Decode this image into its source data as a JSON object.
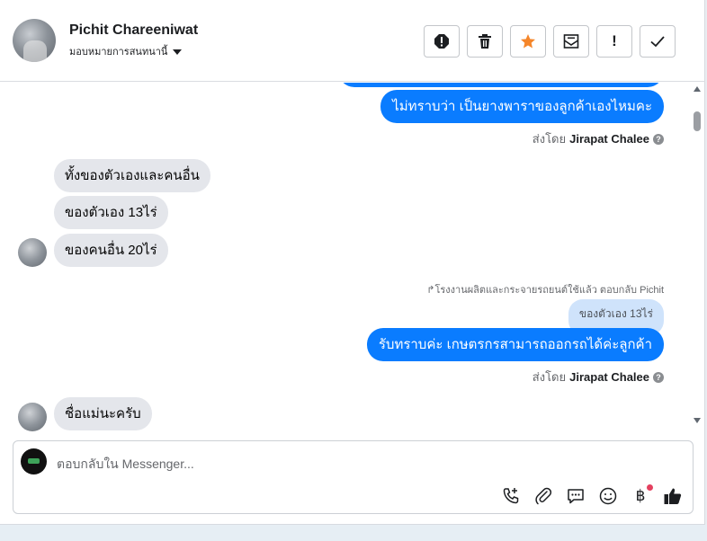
{
  "header": {
    "contact_name": "Pichit Chareeniwat",
    "assign_label": "มอบหมายการสนทนานี้",
    "actions": [
      {
        "name": "spam-icon",
        "color": "#1c1e21"
      },
      {
        "name": "trash-icon",
        "color": "#1c1e21"
      },
      {
        "name": "star-icon",
        "color": "#f5862a"
      },
      {
        "name": "mark-unread-icon",
        "color": "#1c1e21"
      },
      {
        "name": "follow-up-icon",
        "color": "#1c1e21"
      },
      {
        "name": "done-check-icon",
        "color": "#1c1e21"
      }
    ],
    "follow_up_glyph": "!"
  },
  "messages": {
    "out_1": "ไม่ทราบว่า เป็นยางพาราของลูกค้าเองไหมคะ",
    "sent_by_1_prefix": "ส่งโดย",
    "sent_by_1_name": "Jirapat Chalee",
    "in_1": "ทั้งของตัวเองและคนอื่น",
    "in_2": "ของตัวเอง 13ไร่",
    "in_3": "ของคนอื่น 20ไร่",
    "reply_note": "โรงงานผลิตและกระจายรถยนต์ใช้แล้ว ตอบกลับ Pichit",
    "quoted": "ของตัวเอง 13ไร่",
    "out_2": "รับทราบค่ะ เกษตรกรสามารถออกรถได้ค่ะลูกค้า",
    "sent_by_2_prefix": "ส่งโดย",
    "sent_by_2_name": "Jirapat Chalee",
    "in_4": "ชื่อแม่นะครับ"
  },
  "composer": {
    "placeholder": "ตอบกลับใน Messenger...",
    "value": "",
    "tools": [
      "call-add-icon",
      "attachment-icon",
      "saved-reply-icon",
      "emoji-icon",
      "baht-icon",
      "like-icon"
    ],
    "baht_glyph": "฿"
  },
  "colors": {
    "outgoing_bubble": "#0a7cff",
    "incoming_bubble": "#e4e6eb",
    "quoted_bubble": "#cfe3fb",
    "notification_dot": "#e4405f"
  }
}
